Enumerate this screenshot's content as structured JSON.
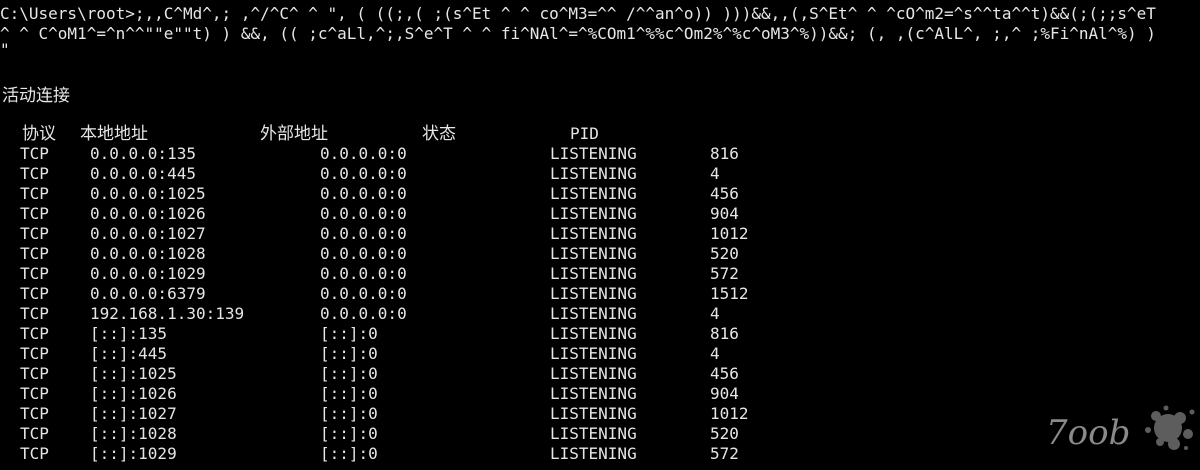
{
  "console": {
    "command_lines": [
      "C:\\Users\\root>;,,C^Md^,; ,^/^C^ ^ \", ( ((;,( ;(s^Et ^ ^ co^M3=^^ /^^an^o)) )))&&,,(,S^Et^ ^ ^cO^m2=^s^^ta^^t)&&(;(;;s^eT",
      "^ ^ C^oM1^=^n^^\"\"e\"\"t) ) &&, (( ;c^aLl,^;,S^e^T ^ ^ fi^NAl^=^%COm1^%%c^Om2%^%c^oM3^%))&&; (, ,(c^AlL^, ;,^ ;%Fi^nAl^%) )",
      "\""
    ],
    "section_title": "活动连接",
    "headers": {
      "protocol": "协议",
      "local_address": "本地地址",
      "foreign_address": "外部地址",
      "state": "状态",
      "pid": "PID"
    },
    "rows": [
      {
        "protocol": "TCP",
        "local": "0.0.0.0:135",
        "foreign": "0.0.0.0:0",
        "state": "LISTENING",
        "pid": "816"
      },
      {
        "protocol": "TCP",
        "local": "0.0.0.0:445",
        "foreign": "0.0.0.0:0",
        "state": "LISTENING",
        "pid": "4"
      },
      {
        "protocol": "TCP",
        "local": "0.0.0.0:1025",
        "foreign": "0.0.0.0:0",
        "state": "LISTENING",
        "pid": "456"
      },
      {
        "protocol": "TCP",
        "local": "0.0.0.0:1026",
        "foreign": "0.0.0.0:0",
        "state": "LISTENING",
        "pid": "904"
      },
      {
        "protocol": "TCP",
        "local": "0.0.0.0:1027",
        "foreign": "0.0.0.0:0",
        "state": "LISTENING",
        "pid": "1012"
      },
      {
        "protocol": "TCP",
        "local": "0.0.0.0:1028",
        "foreign": "0.0.0.0:0",
        "state": "LISTENING",
        "pid": "520"
      },
      {
        "protocol": "TCP",
        "local": "0.0.0.0:1029",
        "foreign": "0.0.0.0:0",
        "state": "LISTENING",
        "pid": "572"
      },
      {
        "protocol": "TCP",
        "local": "0.0.0.0:6379",
        "foreign": "0.0.0.0:0",
        "state": "LISTENING",
        "pid": "1512"
      },
      {
        "protocol": "TCP",
        "local": "192.168.1.30:139",
        "foreign": "0.0.0.0:0",
        "state": "LISTENING",
        "pid": "4"
      },
      {
        "protocol": "TCP",
        "local": "[::]:135",
        "foreign": "[::]:0",
        "state": "LISTENING",
        "pid": "816"
      },
      {
        "protocol": "TCP",
        "local": "[::]:445",
        "foreign": "[::]:0",
        "state": "LISTENING",
        "pid": "4"
      },
      {
        "protocol": "TCP",
        "local": "[::]:1025",
        "foreign": "[::]:0",
        "state": "LISTENING",
        "pid": "456"
      },
      {
        "protocol": "TCP",
        "local": "[::]:1026",
        "foreign": "[::]:0",
        "state": "LISTENING",
        "pid": "904"
      },
      {
        "protocol": "TCP",
        "local": "[::]:1027",
        "foreign": "[::]:0",
        "state": "LISTENING",
        "pid": "1012"
      },
      {
        "protocol": "TCP",
        "local": "[::]:1028",
        "foreign": "[::]:0",
        "state": "LISTENING",
        "pid": "520"
      },
      {
        "protocol": "TCP",
        "local": "[::]:1029",
        "foreign": "[::]:0",
        "state": "LISTENING",
        "pid": "572"
      }
    ]
  },
  "watermark": {
    "text": "7oob",
    "icon": "splatter-logo-icon"
  },
  "colors": {
    "background": "#000000",
    "text": "#e6e6e6",
    "watermark": "#7a7a7a"
  }
}
